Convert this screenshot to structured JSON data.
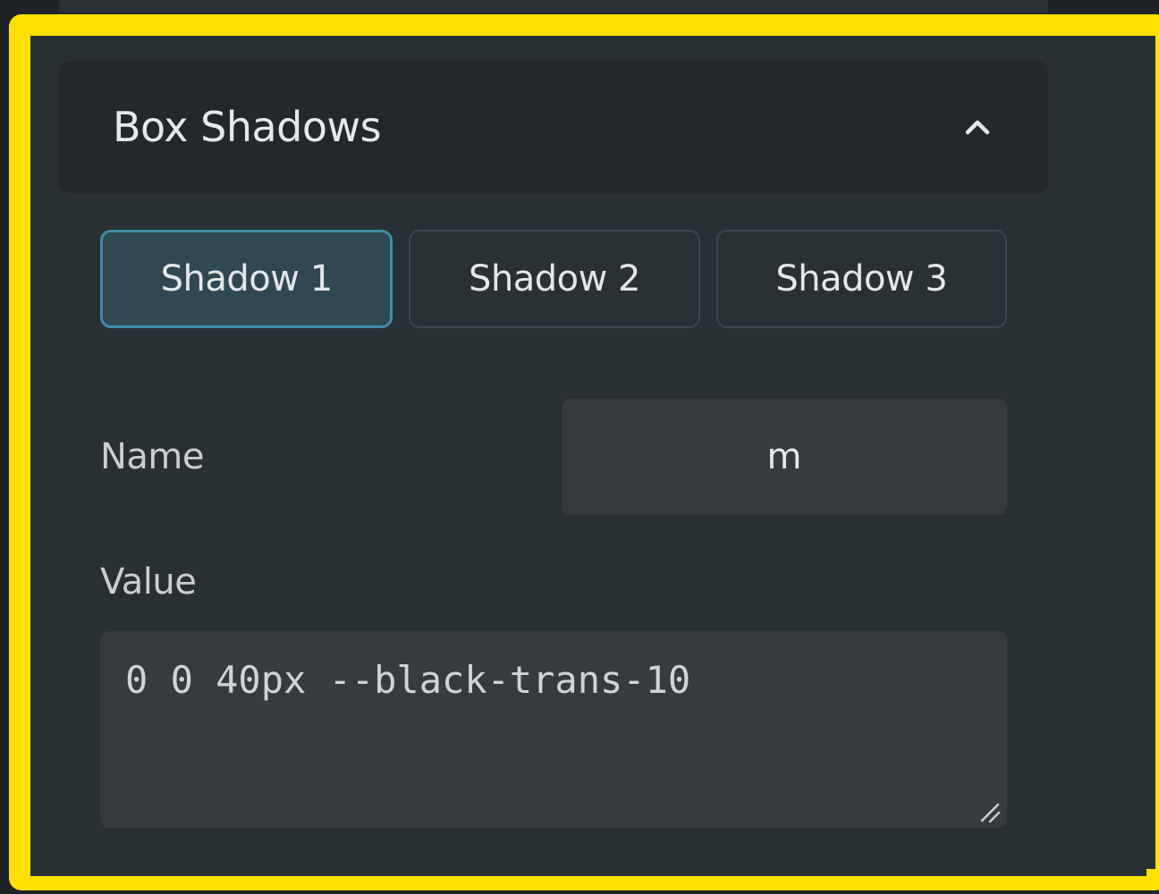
{
  "accordion": {
    "title": "Box Shadows",
    "icon": "chevron-up-icon",
    "expanded": true
  },
  "tabs": [
    {
      "label": "Shadow 1",
      "active": true
    },
    {
      "label": "Shadow 2",
      "active": false
    },
    {
      "label": "Shadow 3",
      "active": false
    }
  ],
  "fields": {
    "name_label": "Name",
    "name_value": "m",
    "value_label": "Value",
    "value_text": "0 0 40px --black-trans-10"
  },
  "colors": {
    "highlight": "#ffe000",
    "panel_bg": "#293033",
    "active_tab_border": "#3e8ea8",
    "input_bg": "#353b3f"
  }
}
